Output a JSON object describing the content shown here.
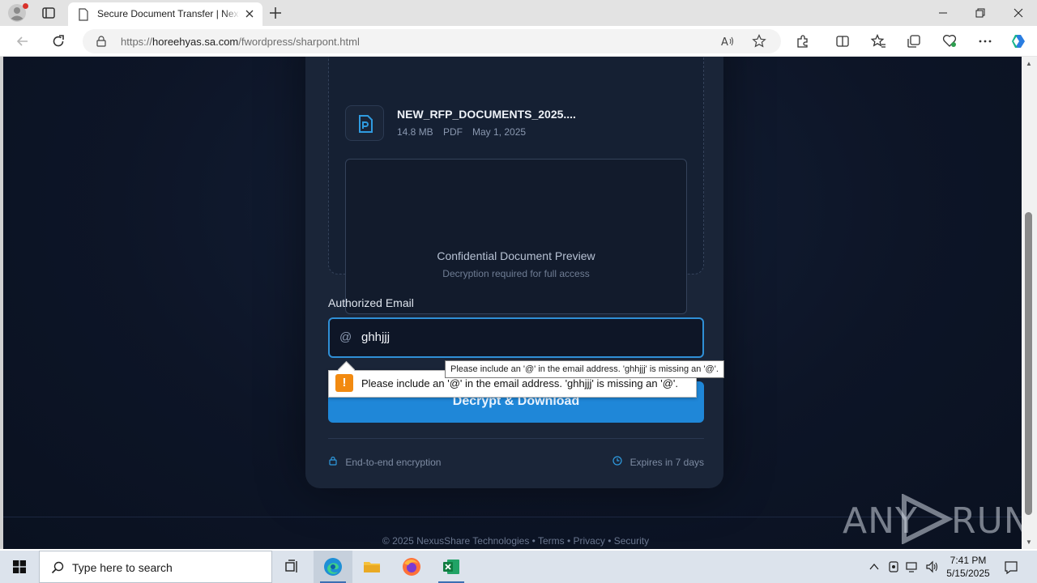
{
  "browser": {
    "tab_title": "Secure Document Transfer | NexusShare",
    "url_prefix": "https://",
    "url_host": "horeehyas.sa.com",
    "url_path": "/fwordpress/sharpont.html"
  },
  "file": {
    "name": "NEW_RFP_DOCUMENTS_2025....",
    "size": "14.8 MB",
    "type": "PDF",
    "date": "May 1, 2025"
  },
  "preview": {
    "title": "Confidential Document Preview",
    "subtitle": "Decryption required for full access"
  },
  "form": {
    "email_label": "Authorized Email",
    "at_symbol": "@",
    "email_value": "ghhjjj",
    "button_label": "Decrypt & Download"
  },
  "card_footer": {
    "encryption": "End-to-end encryption",
    "expiry": "Expires in 7 days"
  },
  "page_footer": "© 2025 NexusShare Technologies • Terms • Privacy • Security",
  "validation": {
    "icon": "!",
    "message": "Please include an '@' in the email address. 'ghhjjj' is missing an '@'.",
    "tooltip": "Please include an '@' in the email address. 'ghhjjj' is missing an '@'."
  },
  "watermark": {
    "left": "ANY",
    "right": "RUN"
  },
  "taskbar": {
    "search_placeholder": "Type here to search",
    "time": "7:41 PM",
    "date": "5/15/2025"
  },
  "colors": {
    "page_bg": "#0e1628",
    "card_bg": "#1a2538",
    "accent": "#1f87d8",
    "warning": "#f28a10"
  }
}
